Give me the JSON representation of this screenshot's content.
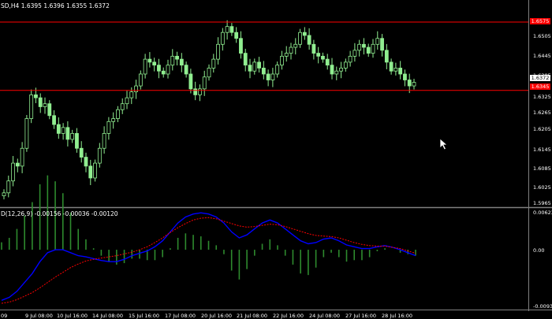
{
  "main_title": "SD,H4  1.6395  1.6396  1.6355  1.6372",
  "macd_title": "D(12,26,9) -0.00156 -0.00036 -0.00120",
  "price_labels": [
    "1.6575",
    "1.6505",
    "1.6445",
    "1.6385",
    "1.6372",
    "1.6325",
    "1.6265",
    "1.6205",
    "1.6145",
    "1.6085",
    "1.6025",
    "1.5965"
  ],
  "macd_labels": [
    "0.00623",
    "0.00",
    "-0.00939"
  ],
  "time_labels": [
    "09",
    "9 Jul 08:00",
    "10 Jul 16:00",
    "14 Jul 08:00",
    "15 Jul 16:00",
    "17 Jul 08:00",
    "20 Jul 16:00",
    "21 Jul 08:00",
    "22 Jul 16:00",
    "24 Jul 08:00",
    "27 Jul 16:00",
    "28 Jul 16:00"
  ],
  "tags": {
    "top_line": "1.6575",
    "current_price": "1.6372",
    "bottom_line": "1.6345"
  },
  "colors": {
    "background": "#000000",
    "candle": "#90ee90",
    "hline": "#ff0000",
    "macd_line": "#0000ff",
    "signal_line": "#ff0000",
    "histogram": "#2e8b2e"
  },
  "chart_data": {
    "type": "candlestick",
    "symbol_timeframe": "H4",
    "ohlc": [
      1.6395,
      1.6396,
      1.6355,
      1.6372
    ],
    "horizontal_lines": [
      1.6575,
      1.6345
    ],
    "price_axis_ticks": [
      1.6505,
      1.6445,
      1.6385,
      1.6325,
      1.6265,
      1.6205,
      1.6145,
      1.6085,
      1.6025,
      1.5965
    ],
    "closes": [
      1.6,
      1.604,
      1.61,
      1.609,
      1.615,
      1.625,
      1.633,
      1.632,
      1.629,
      1.63,
      1.626,
      1.623,
      1.62,
      1.622,
      1.618,
      1.62,
      1.615,
      1.612,
      1.609,
      1.605,
      1.61,
      1.615,
      1.62,
      1.624,
      1.625,
      1.628,
      1.63,
      1.632,
      1.634,
      1.636,
      1.64,
      1.645,
      1.644,
      1.643,
      1.641,
      1.64,
      1.643,
      1.646,
      1.645,
      1.643,
      1.64,
      1.635,
      1.633,
      1.635,
      1.639,
      1.642,
      1.645,
      1.65,
      1.654,
      1.656,
      1.654,
      1.652,
      1.647,
      1.643,
      1.641,
      1.644,
      1.642,
      1.64,
      1.638,
      1.64,
      1.643,
      1.646,
      1.647,
      1.649,
      1.65,
      1.654,
      1.653,
      1.65,
      1.647,
      1.646,
      1.645,
      1.643,
      1.64,
      1.641,
      1.642,
      1.644,
      1.646,
      1.648,
      1.65,
      1.649,
      1.647,
      1.65,
      1.652,
      1.648,
      1.644,
      1.641,
      1.642,
      1.64,
      1.638,
      1.636,
      1.6372
    ],
    "macd": {
      "params": [
        12,
        26,
        9
      ],
      "values": [
        -0.00156,
        -0.00036,
        -0.0012
      ],
      "ylim": [
        -0.00939,
        0.00623
      ],
      "macd_series": [
        -0.0085,
        -0.008,
        -0.007,
        -0.0055,
        -0.004,
        -0.002,
        -0.0005,
        0.0,
        0.0,
        -0.0005,
        -0.001,
        -0.0012,
        -0.0015,
        -0.0018,
        -0.002,
        -0.002,
        -0.0016,
        -0.001,
        -0.0006,
        -0.0002,
        0.0005,
        0.0015,
        0.003,
        0.0045,
        0.0055,
        0.006,
        0.0062,
        0.006,
        0.0055,
        0.0045,
        0.003,
        0.002,
        0.0025,
        0.0035,
        0.0045,
        0.005,
        0.0045,
        0.0035,
        0.0025,
        0.0015,
        0.001,
        0.0012,
        0.0018,
        0.002,
        0.0015,
        0.0008,
        0.0005,
        0.0002,
        0.0002,
        0.0005,
        0.0007,
        0.0004,
        0.0,
        -0.0005,
        -0.001
      ],
      "signal_series": [
        -0.009,
        -0.0088,
        -0.0084,
        -0.0078,
        -0.0072,
        -0.0064,
        -0.0055,
        -0.0046,
        -0.0038,
        -0.003,
        -0.0024,
        -0.0019,
        -0.0016,
        -0.0014,
        -0.0012,
        -0.001,
        -0.0007,
        -0.0004,
        0.0,
        0.0005,
        0.0012,
        0.002,
        0.0029,
        0.0037,
        0.0044,
        0.005,
        0.0053,
        0.0054,
        0.0052,
        0.0048,
        0.0044,
        0.004,
        0.0038,
        0.0039,
        0.0041,
        0.0043,
        0.0042,
        0.0039,
        0.0035,
        0.0031,
        0.0027,
        0.0024,
        0.0023,
        0.0022,
        0.002,
        0.0016,
        0.0012,
        0.0009,
        0.0007,
        0.0006,
        0.0006,
        0.0004,
        0.0002,
        -0.0002,
        -0.0006
      ]
    }
  }
}
